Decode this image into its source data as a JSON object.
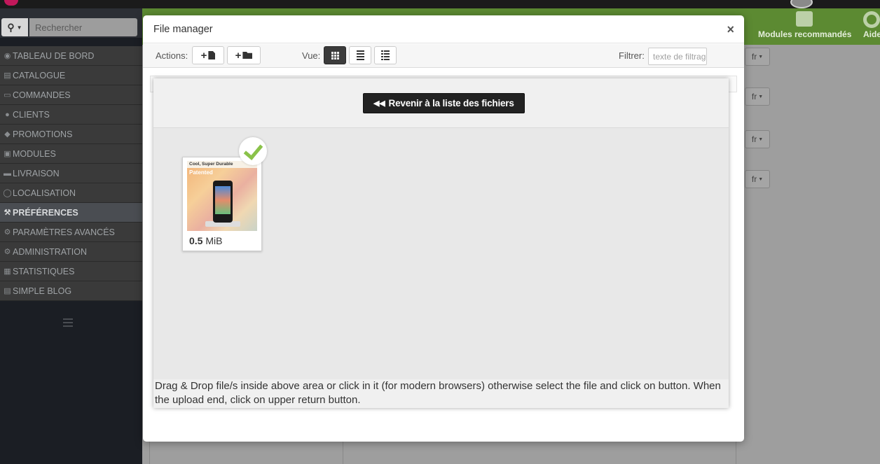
{
  "search": {
    "placeholder": "Rechercher"
  },
  "sidebar": {
    "items": [
      {
        "label": "TABLEAU DE BORD",
        "icon": "dashboard-icon"
      },
      {
        "label": "CATALOGUE",
        "icon": "book-icon"
      },
      {
        "label": "COMMANDES",
        "icon": "credit-card-icon"
      },
      {
        "label": "CLIENTS",
        "icon": "users-icon"
      },
      {
        "label": "PROMOTIONS",
        "icon": "tags-icon"
      },
      {
        "label": "MODULES",
        "icon": "puzzle-icon"
      },
      {
        "label": "LIVRAISON",
        "icon": "truck-icon"
      },
      {
        "label": "LOCALISATION",
        "icon": "globe-icon"
      },
      {
        "label": "PRÉFÉRENCES",
        "icon": "wrench-icon",
        "active": true
      },
      {
        "label": "PARAMÈTRES AVANCÉS",
        "icon": "cogs-icon"
      },
      {
        "label": "ADMINISTRATION",
        "icon": "cog-icon"
      },
      {
        "label": "STATISTIQUES",
        "icon": "bar-chart-icon"
      },
      {
        "label": "SIMPLE BLOG",
        "icon": "file-text-icon"
      }
    ]
  },
  "header": {
    "modules_label": "Modules recommandés",
    "aide_label": "Aide"
  },
  "lang": {
    "label": "fr"
  },
  "modal": {
    "title": "File manager",
    "close_glyph": "×",
    "toolbar": {
      "actions_label": "Actions:",
      "vue_label": "Vue:",
      "filter_label": "Filtrer:",
      "filter_placeholder": "texte de filtrage"
    },
    "return_button": "Revenir à la liste des fichiers",
    "file": {
      "thumb_title": "Cool, Super Durable",
      "thumb_subtitle": "Patented",
      "size_value": "0.5",
      "size_unit": "MiB"
    },
    "hint": "Drag & Drop file/s inside above area or click in it (for modern browsers) otherwise select the file and click on button. When the upload end, click on upper return button."
  },
  "colors": {
    "header_green": "#5c8a32",
    "check_green": "#8ac249",
    "sidebar_bg": "#1b1e24"
  }
}
